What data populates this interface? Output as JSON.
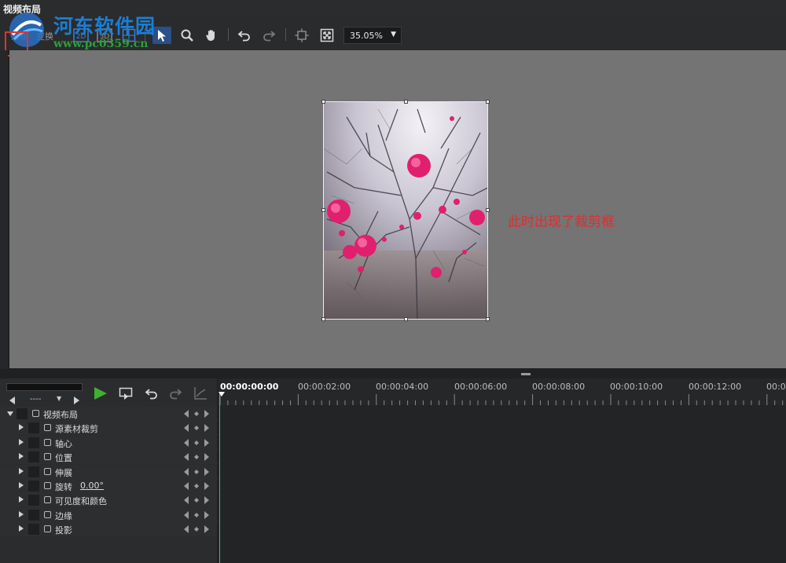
{
  "window": {
    "title": "视频布局"
  },
  "toolbar": {
    "tabs": [
      "编辑",
      "变换"
    ],
    "mode_2d": "2D",
    "mode_3d": "3D",
    "zoom_value": "35.05%",
    "zoom_arrow": "▼",
    "icons": [
      "grid-icon",
      "select-arrow-icon",
      "zoom-magnifier-icon",
      "hand-pan-icon",
      "undo-icon",
      "redo-icon",
      "fit-frame-icon",
      "fullscreen-icon"
    ]
  },
  "watermark": {
    "title": "河东软件园",
    "url": "www.pc0359.cn"
  },
  "preview": {
    "annotation": "此时出现了裁剪框",
    "annotation_color": "#e22d2d",
    "canvas_color": "#747474"
  },
  "timeline": {
    "current_time": "00:00:00:00",
    "time_labels": [
      "00:00:02:00",
      "00:00:04:00",
      "00:00:06:00",
      "00:00:08:00",
      "00:00:10:00",
      "00:00:12:00",
      "00:0"
    ],
    "dropdown_value": "----",
    "tracks": [
      {
        "label": "视频布局",
        "expanded": true,
        "value": ""
      },
      {
        "label": "源素材裁剪",
        "expanded": false,
        "value": ""
      },
      {
        "label": "轴心",
        "expanded": false,
        "value": ""
      },
      {
        "label": "位置",
        "expanded": false,
        "value": ""
      },
      {
        "label": "伸展",
        "expanded": false,
        "value": ""
      },
      {
        "label": "旋转",
        "expanded": false,
        "value": "0.00°"
      },
      {
        "label": "可见度和颜色",
        "expanded": false,
        "value": ""
      },
      {
        "label": "边缘",
        "expanded": false,
        "value": ""
      },
      {
        "label": "投影",
        "expanded": false,
        "value": ""
      }
    ],
    "playhead_color": "#2bb8b8"
  }
}
